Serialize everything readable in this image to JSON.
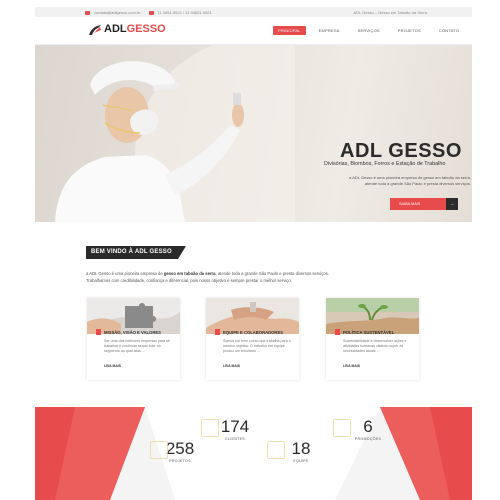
{
  "topbar": {
    "email": "contato@adlgesso.com.br",
    "phones": "11 2651-9521 / 11 94651-9521",
    "tagline": "ADL Gesso – Gesso em Taboão da Serra"
  },
  "header": {
    "logo_text_primary": "ADL",
    "logo_text_accent": "GESSO",
    "nav": [
      {
        "label": "PRINCIPAL",
        "active": true
      },
      {
        "label": "EMPRESA",
        "active": false
      },
      {
        "label": "SERVIÇOS",
        "active": false
      },
      {
        "label": "PROJETOS",
        "active": false
      },
      {
        "label": "CONTATO",
        "active": false
      }
    ]
  },
  "hero": {
    "title": "ADL GESSO",
    "subtitle": "Divisórias, Biombos, Forros e Estação de Trabalho",
    "text_line1": "a ADL Gesso é uma pioneira empresa de gesso em taboão da serra,",
    "text_line2": "atende toda a grande São Paulo e presta diversos serviços.",
    "button_label": "SAIBA MAIS",
    "button_arrow": "→"
  },
  "welcome": {
    "heading": "BEM VINDO À ADL GESSO",
    "line1_a": "a ADL Gesso é uma pioneira empresa de ",
    "line1_b": "gesso em taboão da serra",
    "line1_c": ", atende toda a grande São Paulo e presta diversos serviços.",
    "line2": "Trabalhamos com credibilidade, confiança e diferencial, pois nosso objetivo é sempre prestar o melhor serviço."
  },
  "cards": [
    {
      "title": "MISSÃO, VISÃO E VALORES",
      "text": "Ser uma das melhores empresas para se trabalhar e continuar sendo líder no segmento ao qual atua ...",
      "link": "LEIA MAIS"
    },
    {
      "title": "EQUIPE E COLABORADORES",
      "text": "Somos um time coeso que trabalha para o mesmo objetivo. O trabalho em equipe produz um resultado ...",
      "link": "LEIA MAIS"
    },
    {
      "title": "POLÍTICA SUSTENTÁVEL",
      "text": "Sustentabilidade é desenvolver ações e atividades humanas visando suprir as necessidades atuais ...",
      "link": "LEIA MAIS"
    }
  ],
  "stats": [
    {
      "number": "258",
      "label": "PROJETOS"
    },
    {
      "number": "174",
      "label": "CLIENTES"
    },
    {
      "number": "18",
      "label": "EQUIPE"
    },
    {
      "number": "6",
      "label": "PROMOÇÕES"
    }
  ],
  "colors": {
    "accent": "#e84b4b",
    "dark": "#2b2b2b"
  }
}
